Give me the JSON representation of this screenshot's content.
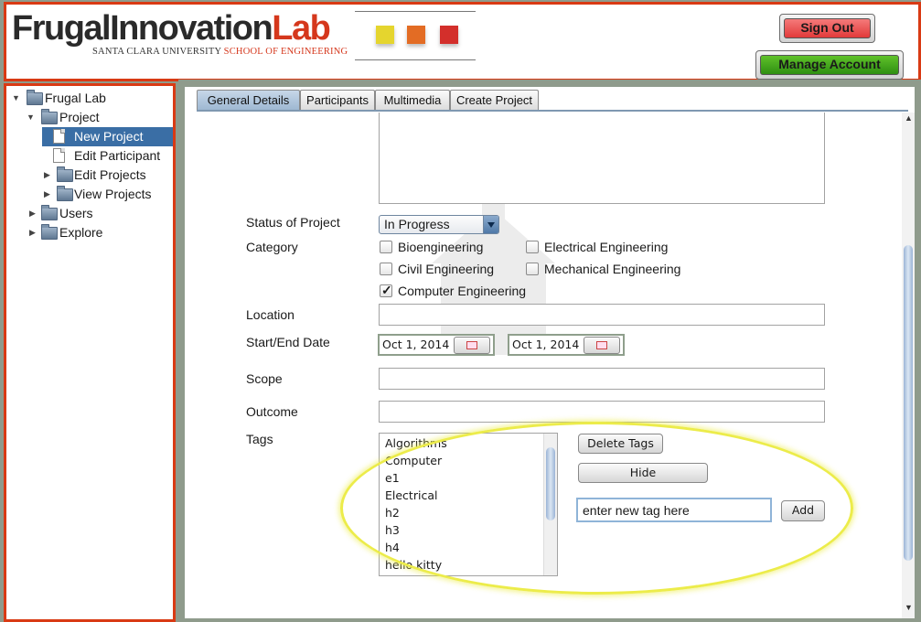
{
  "header": {
    "logo_part1": "Frugal",
    "logo_part2": "Innovation",
    "logo_part3": "Lab",
    "logo_university": "SANTA CLARA UNIVERSITY",
    "logo_school": "SCHOOL OF ENGINEERING",
    "sign_out_label": "Sign Out",
    "manage_account_label": "Manage Account",
    "colors": {
      "sign_out": "#e84545",
      "manage_account": "#3ea318",
      "brand_red": "#d5371c"
    }
  },
  "sidebar": {
    "root": "Frugal Lab",
    "project": "Project",
    "new_project": "New Project",
    "edit_participant": "Edit Participant",
    "edit_projects": "Edit Projects",
    "view_projects": "View Projects",
    "users": "Users",
    "explore": "Explore",
    "selected": "New Project"
  },
  "tabs": [
    {
      "label": "General Details",
      "active": true
    },
    {
      "label": "Participants",
      "active": false
    },
    {
      "label": "Multimedia",
      "active": false
    },
    {
      "label": "Create Project",
      "active": false
    }
  ],
  "form": {
    "status_label": "Status of Project",
    "status_value": "In Progress",
    "category_label": "Category",
    "categories": [
      {
        "label": "Bioengineering",
        "checked": false
      },
      {
        "label": "Electrical Engineering",
        "checked": false
      },
      {
        "label": "Civil Engineering",
        "checked": false
      },
      {
        "label": "Mechanical Engineering",
        "checked": false
      },
      {
        "label": "Computer Engineering",
        "checked": true
      }
    ],
    "location_label": "Location",
    "date_label": "Start/End Date",
    "start_date": "Oct 1, 2014",
    "end_date": "Oct 1, 2014",
    "scope_label": "Scope",
    "outcome_label": "Outcome",
    "tags_label": "Tags",
    "tags": [
      "Algorithms",
      "Computer",
      "e1",
      "Electrical",
      "h2",
      "h3",
      "h4",
      "hello kitty"
    ],
    "delete_tags_label": "Delete Tags",
    "hide_label": "Hide",
    "new_tag_value": "enter new tag here",
    "add_label": "Add"
  }
}
